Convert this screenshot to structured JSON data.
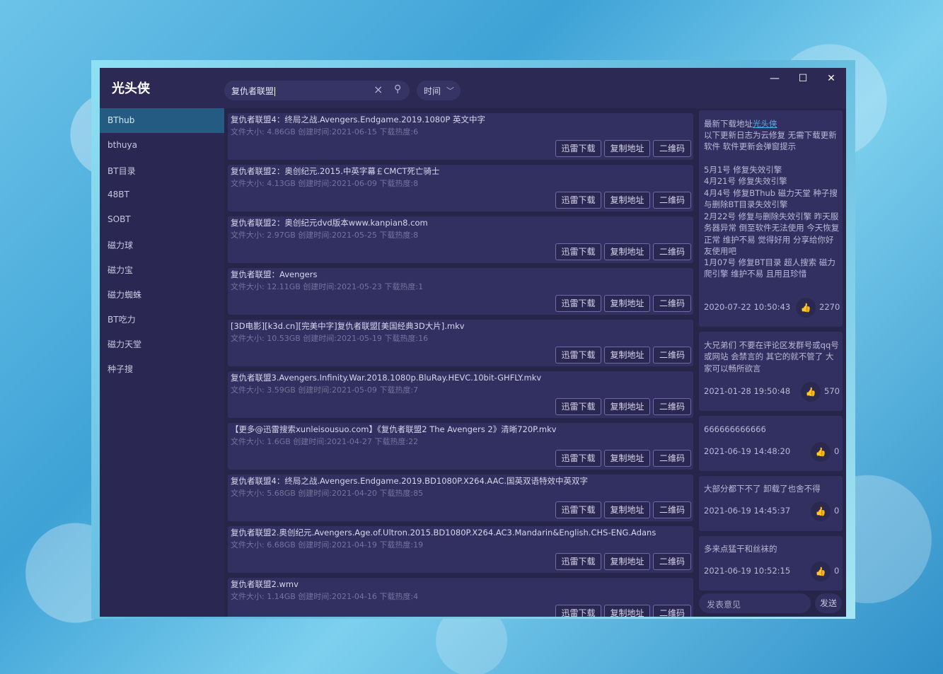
{
  "app": {
    "title": "光头侠"
  },
  "search": {
    "value": "复仇者联盟",
    "clear_icon": "close-icon",
    "search_icon": "search-icon"
  },
  "sort": {
    "label": "时间"
  },
  "window_controls": {
    "minimize": "—",
    "maximize": "☐",
    "close": "✕"
  },
  "sidebar": {
    "items": [
      {
        "label": "BThub",
        "active": true
      },
      {
        "label": "bthuya"
      },
      {
        "label": "BT目录"
      },
      {
        "label": "48BT"
      },
      {
        "label": "SOBT"
      },
      {
        "label": "磁力球"
      },
      {
        "label": "磁力宝"
      },
      {
        "label": "磁力蜘蛛"
      },
      {
        "label": "BT吃力"
      },
      {
        "label": "磁力天堂"
      },
      {
        "label": "种子搜"
      }
    ]
  },
  "buttons": {
    "thunder": "迅雷下载",
    "copy": "复制地址",
    "qr": "二维码"
  },
  "results": [
    {
      "title": "复仇者联盟4：终局之战.Avengers.Endgame.2019.1080P 英文中字",
      "meta": "文件大小: 4.86GB  创建时间:2021-06-15 下载热度:6"
    },
    {
      "title": "复仇者联盟2：奥创纪元.2015.中英字幕￡CMCT死亡骑士",
      "meta": "文件大小: 4.13GB  创建时间:2021-06-09 下载热度:8"
    },
    {
      "title": "复仇者联盟2：奥创纪元dvd版本www.kanpian8.com",
      "meta": "文件大小: 2.97GB  创建时间:2021-05-25 下载热度:8"
    },
    {
      "title": "复仇者联盟：Avengers",
      "meta": "文件大小: 12.11GB  创建时间:2021-05-23 下载热度:1"
    },
    {
      "title": "[3D电影][k3d.cn][完美中字]复仇者联盟[美国经典3D大片].mkv",
      "meta": "文件大小: 10.53GB  创建时间:2021-05-19 下载热度:16"
    },
    {
      "title": "复仇者联盟3.Avengers.Infinity.War.2018.1080p.BluRay.HEVC.10bit-GHFLY.mkv",
      "meta": "文件大小: 3.59GB  创建时间:2021-05-09 下载热度:7"
    },
    {
      "title": "【更多@迅雷搜索xunleisousuo.com】《复仇者联盟2 The Avengers 2》清晰720P.mkv",
      "meta": "文件大小: 1.6GB  创建时间:2021-04-27 下载热度:22"
    },
    {
      "title": "复仇者联盟4：终局之战.Avengers.Endgame.2019.BD1080P.X264.AAC.国英双语特效中英双字",
      "meta": "文件大小: 5.68GB  创建时间:2021-04-20 下载热度:85"
    },
    {
      "title": "复仇者联盟2.奥创纪元.Avengers.Age.of.Ultron.2015.BD1080P.X264.AC3.Mandarin&English.CHS-ENG.Adans",
      "meta": "文件大小: 6.68GB  创建时间:2021-04-19 下载热度:19"
    },
    {
      "title": "复仇者联盟2.wmv",
      "meta": "文件大小: 1.14GB  创建时间:2021-04-16 下载热度:4"
    }
  ],
  "announcement": {
    "prefix": "最新下载地址",
    "link": "光头侠",
    "lines": [
      "以下更新日志为云修复 无需下载更新软件 软件更新会弹窗提示",
      "5月1号 修复失效引擎",
      "4月21号 修复失效引擎",
      "4月4号 修复BThub 磁力天堂 种子搜与删除BT目录失效引擎",
      "2月22号 修复与删除失效引擎 昨天服务器异常 倒至软件无法使用 今天恢复正常 维护不易 觉得好用 分享给你好友使用吧",
      "1月07号 修复BT目录 超人搜索 磁力爬引擎 维护不易 且用且珍惜"
    ],
    "date": "2020-07-22 10:50:43",
    "likes": "2270"
  },
  "comments": [
    {
      "text": "大兄弟们 不要在评论区发群号或qq号或网站 会禁言的 其它的就不管了 大家可以畅所欲言",
      "date": "2021-01-28 19:50:48",
      "likes": "570"
    },
    {
      "text": "666666666666",
      "date": "2021-06-19 14:48:20",
      "likes": "0"
    },
    {
      "text": "大部分都下不了 卸载了也舍不得",
      "date": "2021-06-19 14:45:37",
      "likes": "0"
    },
    {
      "text": "多来点猛干和丝袜的",
      "date": "2021-06-19 10:52:15",
      "likes": "0"
    }
  ],
  "feedback": {
    "placeholder": "发表意见",
    "send": "发送"
  },
  "icons": {
    "like": "thumbs-up-icon",
    "sort_chevron": "chevron-down-icon"
  },
  "colors": {
    "accent": "#235b82",
    "window_bg": "#272549",
    "card_bg": "#323060",
    "link": "#4fb3ea"
  }
}
